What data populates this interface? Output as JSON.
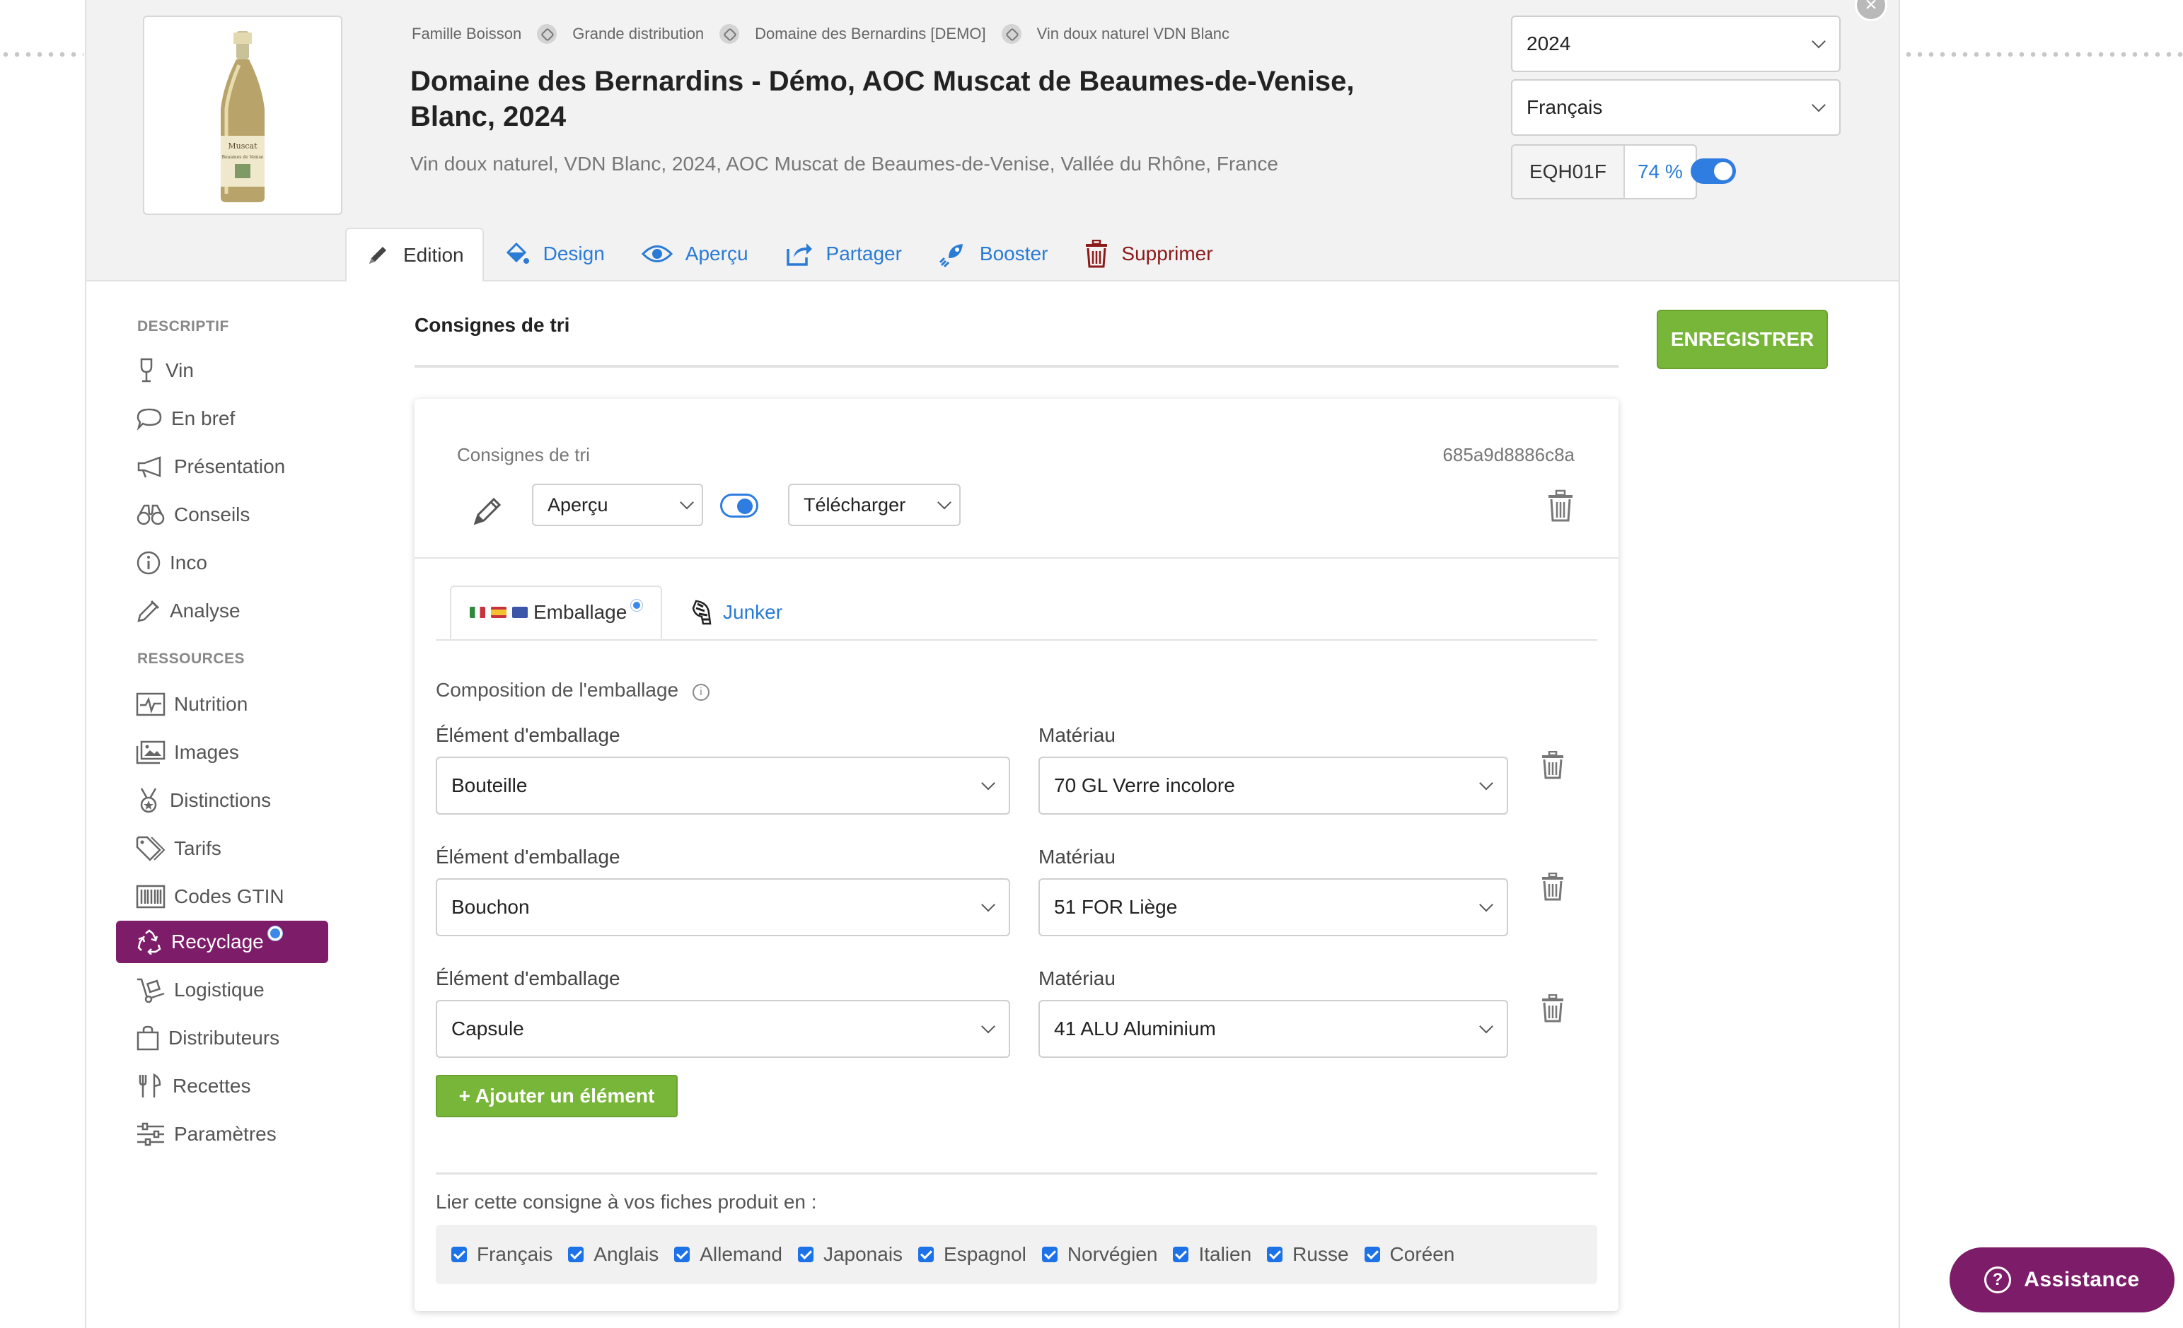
{
  "breadcrumb": [
    "Famille Boisson",
    "Grande distribution",
    "Domaine des Bernardins [DEMO]",
    "Vin doux naturel VDN Blanc"
  ],
  "product": {
    "title": "Domaine des Bernardins - Démo, AOC Muscat de Beaumes-de-Venise, Blanc, 2024",
    "subtitle": "Vin doux naturel, VDN Blanc, 2024, AOC Muscat de Beaumes-de-Venise, Vallée du Rhône, France",
    "label_line1": "Muscat",
    "label_line2": "Beaumes de Venise"
  },
  "header": {
    "year": "2024",
    "language": "Français",
    "code": "EQH01F",
    "percent": "74 %",
    "close_glyph": "×"
  },
  "tabs": [
    {
      "label": "Edition",
      "icon": "pencil-icon"
    },
    {
      "label": "Design",
      "icon": "paint-bucket-icon"
    },
    {
      "label": "Aperçu",
      "icon": "eye-icon"
    },
    {
      "label": "Partager",
      "icon": "share-icon"
    },
    {
      "label": "Booster",
      "icon": "rocket-icon"
    },
    {
      "label": "Supprimer",
      "icon": "trash-icon"
    }
  ],
  "sidebar": {
    "group1": "DESCRIPTIF",
    "group2": "RESSOURCES",
    "items": [
      "Vin",
      "En bref",
      "Présentation",
      "Conseils",
      "Inco",
      "Analyse",
      "Nutrition",
      "Images",
      "Distinctions",
      "Tarifs",
      "Codes GTIN",
      "Recyclage",
      "Logistique",
      "Distributeurs",
      "Recettes",
      "Paramètres"
    ]
  },
  "section": {
    "title": "Consignes de tri",
    "save_label": "ENREGISTRER"
  },
  "card": {
    "label": "Consignes de tri",
    "id": "685a9d8886c8a",
    "mode": "Aperçu",
    "download": "Télécharger",
    "tab_packaging": "Emballage",
    "tab_junker": "Junker",
    "composition_label": "Composition de l'emballage",
    "info_glyph": "i",
    "element_label": "Élément d'emballage",
    "material_label": "Matériau",
    "rows": [
      {
        "element": "Bouteille",
        "material": "70 GL Verre incolore"
      },
      {
        "element": "Bouchon",
        "material": "51 FOR Liège"
      },
      {
        "element": "Capsule",
        "material": "41 ALU Aluminium"
      }
    ],
    "add_label": "+ Ajouter un élément",
    "link_label": "Lier cette consigne à vos fiches produit en :",
    "languages": [
      "Français",
      "Anglais",
      "Allemand",
      "Japonais",
      "Espagnol",
      "Norvégien",
      "Italien",
      "Russe",
      "Coréen"
    ]
  },
  "assistance": {
    "label": "Assistance",
    "glyph": "?"
  },
  "colors": {
    "accent_blue": "#2a7bd5",
    "brand_purple": "#7d1d6a",
    "save_green": "#78b63a",
    "danger": "#8b1a1a"
  }
}
